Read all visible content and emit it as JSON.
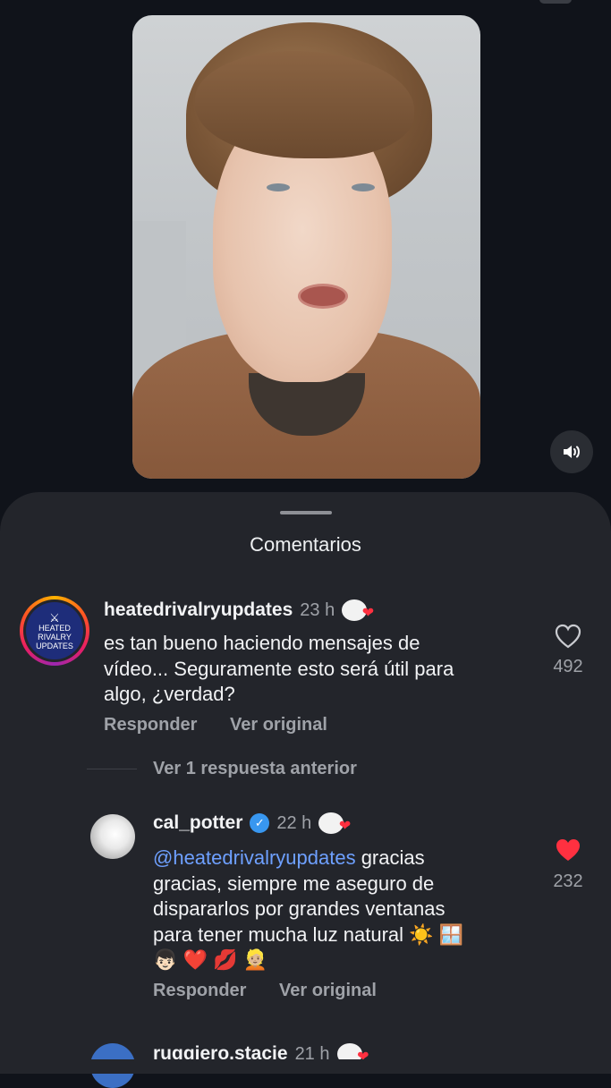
{
  "video": {
    "volume_icon": "speaker-icon"
  },
  "comments_sheet": {
    "title": "Comentarios"
  },
  "comments": [
    {
      "username": "heatedrivalryupdates",
      "time": "23 h",
      "avatar_text": [
        "HEATED",
        "RIVALRY",
        "UPDATES"
      ],
      "text": "es tan bueno haciendo mensajes de vídeo... Seguramente esto será útil para algo, ¿verdad?",
      "lines": [
        "es tan bueno haciendo mensajes de",
        "vídeo... Seguramente esto será útil para",
        "algo, ¿verdad?"
      ],
      "likes": "492",
      "liked": false,
      "reply_label": "Responder",
      "original_label": "Ver original",
      "view_replies": "Ver 1 respuesta anterior"
    },
    {
      "username": "cal_potter",
      "verified": true,
      "time": "22 h",
      "mention": "@heatedrivalryupdates",
      "lines": [
        " gracias",
        "gracias, siempre me aseguro de",
        "dispararlos por grandes ventanas",
        "para tener mucha luz natural ☀️ 🪟",
        "👦🏻 ❤️ 💋 👱🏼"
      ],
      "likes": "232",
      "liked": true,
      "reply_label": "Responder",
      "original_label": "Ver original"
    },
    {
      "username": "ruggiero.stacie",
      "time": "21 h"
    }
  ],
  "colors": {
    "background": "#10131a",
    "sheet": "#23252b",
    "mention": "#6ea0ff",
    "like_active": "#ff3040",
    "muted_text": "#9fa2a8"
  }
}
